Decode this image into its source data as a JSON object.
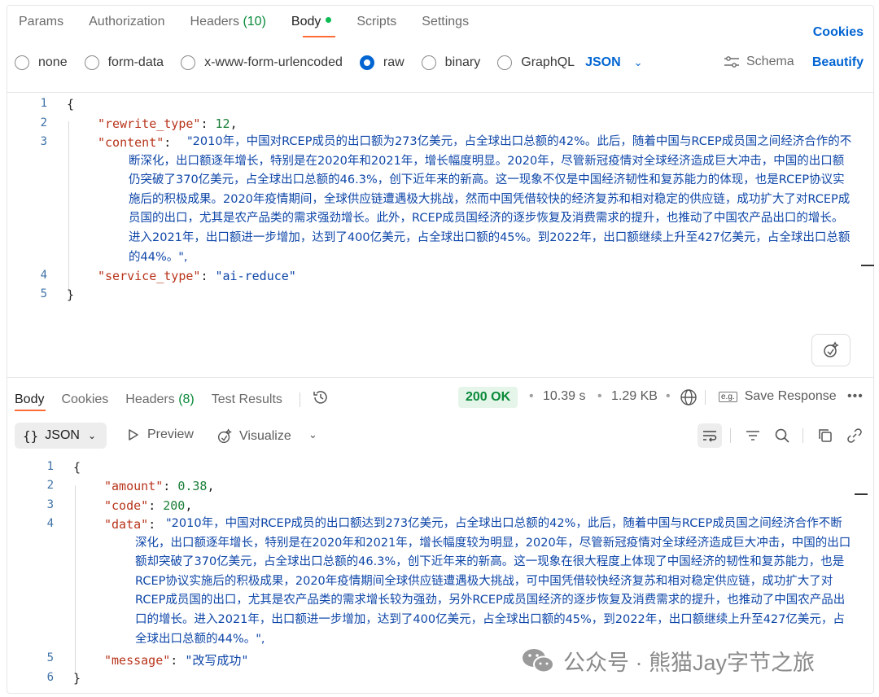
{
  "request": {
    "tabs": [
      {
        "label": "Params"
      },
      {
        "label": "Authorization"
      },
      {
        "label": "Headers ",
        "count": "(10)"
      },
      {
        "label": "Body"
      },
      {
        "label": "Scripts"
      },
      {
        "label": "Settings"
      }
    ],
    "cookies_label": "Cookies",
    "body_types": [
      "none",
      "form-data",
      "x-www-form-urlencoded",
      "raw",
      "binary",
      "GraphQL"
    ],
    "selected_body_type": "raw",
    "language": "JSON",
    "schema_label": "Schema",
    "beautify_label": "Beautify",
    "line_numbers": [
      "1",
      "2",
      "3",
      "4",
      "5"
    ],
    "code": {
      "open_brace": "{",
      "close_brace": "}",
      "rewrite_type_key": "\"rewrite_type\"",
      "rewrite_type_value": "12",
      "content_key": "\"content\"",
      "content_value": "\"2010年，中国对RCEP成员的出口额为273亿美元，占全球出口总额的42%。此后，随着中国与RCEP成员国之间经济合作的不断深化，出口额逐年增长，特别是在2020年和2021年，增长幅度明显。2020年，尽管新冠疫情对全球经济造成巨大冲击，中国的出口额仍突破了370亿美元，占全球出口总额的46.3%，创下近年来的新高。这一现象不仅是中国经济韧性和复苏能力的体现，也是RCEP协议实施后的积极成果。2020年疫情期间，全球供应链遭遇极大挑战，然而中国凭借较快的经济复苏和相对稳定的供应链，成功扩大了对RCEP成员国的出口，尤其是农产品类的需求强劲增长。此外，RCEP成员国经济的逐步恢复及消费需求的提升，也推动了中国农产品出口的增长。进入2021年，出口额进一步增加，达到了400亿美元，占全球出口额的45%。到2022年，出口额继续上升至427亿美元，占全球出口总额的44%。\"",
      "service_type_key": "\"service_type\"",
      "service_type_value": "\"ai-reduce\""
    }
  },
  "response": {
    "tabs": [
      {
        "label": "Body"
      },
      {
        "label": "Cookies"
      },
      {
        "label": "Headers ",
        "count": "(8)"
      },
      {
        "label": "Test Results"
      }
    ],
    "status": "200 OK",
    "time": "10.39 s",
    "size": "1.29 KB",
    "save_label": "Save Response",
    "eg_label": "e.g.",
    "format": "JSON",
    "preview_label": "Preview",
    "visualize_label": "Visualize",
    "line_numbers": [
      "1",
      "2",
      "3",
      "4",
      "5",
      "6"
    ],
    "code": {
      "open_brace": "{",
      "close_brace": "}",
      "amount_key": "\"amount\"",
      "amount_value": "0.38",
      "code_key": "\"code\"",
      "code_value": "200",
      "data_key": "\"data\"",
      "data_value": "\"2010年，中国对RCEP成员的出口额达到273亿美元，占全球出口总额的42%，此后，随着中国与RCEP成员国之间经济合作不断深化，出口额逐年增长，特别是在2020年和2021年，增长幅度较为明显，2020年，尽管新冠疫情对全球经济造成巨大冲击，中国的出口额却突破了370亿美元，占全球出口总额的46.3%，创下近年来的新高。这一现象在很大程度上体现了中国经济的韧性和复苏能力，也是RCEP协议实施后的积极成果，2020年疫情期间全球供应链遭遇极大挑战，可中国凭借较快经济复苏和相对稳定供应链，成功扩大了对RCEP成员国的出口，尤其是农产品类的需求增长较为强劲，另外RCEP成员国经济的逐步恢复及消费需求的提升，也推动了中国农产品出口的增长。进入2021年，出口额进一步增加，达到了400亿美元，占全球出口额的45%，到2022年，出口额继续上升至427亿美元，占全球出口总额的44%。\"",
      "message_key": "\"message\"",
      "message_value": "\"改写成功\""
    }
  },
  "watermark": "公众号 · 熊猫Jay字节之旅",
  "colors": {
    "accent": "#ff6c37",
    "link": "#0265d2",
    "success": "#0a8a3a",
    "json_key": "#b8341b",
    "json_string": "#0e46a8"
  }
}
